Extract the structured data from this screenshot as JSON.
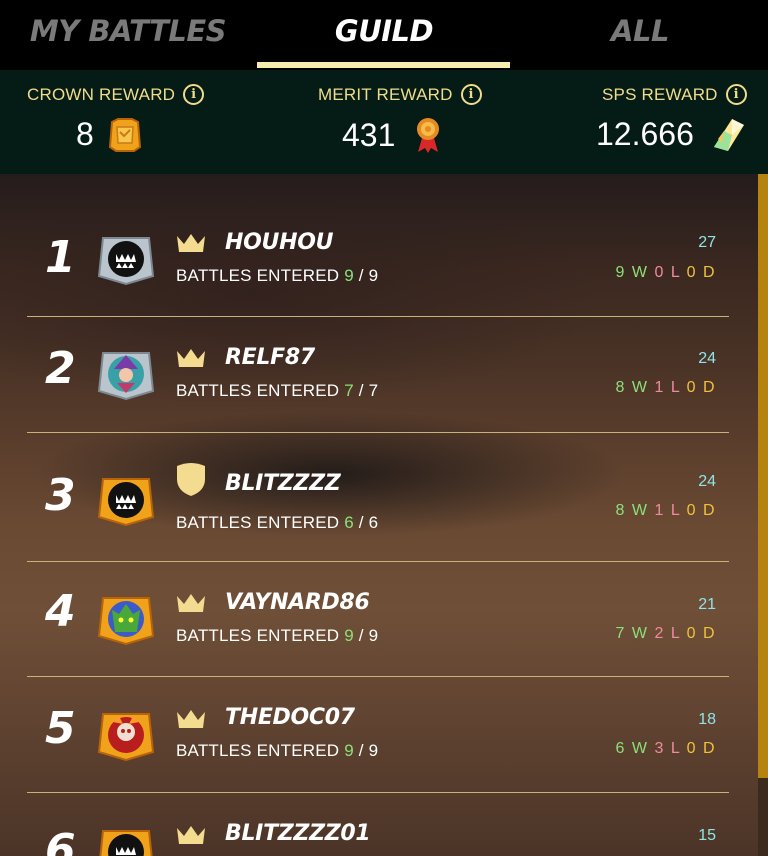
{
  "tabs": [
    {
      "label": "MY BATTLES",
      "active": false
    },
    {
      "label": "GUILD",
      "active": true
    },
    {
      "label": "ALL",
      "active": false
    }
  ],
  "rewards": {
    "crown": {
      "label": "CROWN REWARD",
      "value": "8",
      "icon": "crown-token-icon"
    },
    "merit": {
      "label": "MERIT REWARD",
      "value": "431",
      "icon": "merit-medal-icon"
    },
    "sps": {
      "label": "SPS REWARD",
      "value": "12.666",
      "icon": "sps-crystal-icon"
    },
    "info_glyph": "i"
  },
  "battles_label": "BATTLES ENTERED",
  "players": [
    {
      "rank": "1",
      "name": "HOUHOU",
      "badge": "crown-icon",
      "entered": "9",
      "total": "9",
      "score": "27",
      "w": "9",
      "l": "0",
      "d": "0"
    },
    {
      "rank": "2",
      "name": "RELF87",
      "badge": "crown-icon",
      "entered": "7",
      "total": "7",
      "score": "24",
      "w": "8",
      "l": "1",
      "d": "0"
    },
    {
      "rank": "3",
      "name": "BLITZZZZ",
      "badge": "shield-icon",
      "entered": "6",
      "total": "6",
      "score": "24",
      "w": "8",
      "l": "1",
      "d": "0"
    },
    {
      "rank": "4",
      "name": "VAYNARD86",
      "badge": "crown-icon",
      "entered": "9",
      "total": "9",
      "score": "21",
      "w": "7",
      "l": "2",
      "d": "0"
    },
    {
      "rank": "5",
      "name": "THEDOC07",
      "badge": "crown-icon",
      "entered": "9",
      "total": "9",
      "score": "18",
      "w": "6",
      "l": "3",
      "d": "0"
    },
    {
      "rank": "6",
      "name": "BLITZZZZ01",
      "badge": "crown-icon",
      "entered": "",
      "total": "",
      "score": "15",
      "w": "",
      "l": "",
      "d": ""
    }
  ],
  "record_letters": {
    "w": "W",
    "l": "L",
    "d": "D"
  },
  "colors": {
    "accent_tab": "#f5ecae",
    "reward_label": "#f0dc8c",
    "reward_bg": "#051b16",
    "score": "#8fe4e6",
    "win": "#8ce07a",
    "loss": "#f08aa0",
    "draw": "#f0c13a",
    "scrollbar": "#b7830f"
  }
}
